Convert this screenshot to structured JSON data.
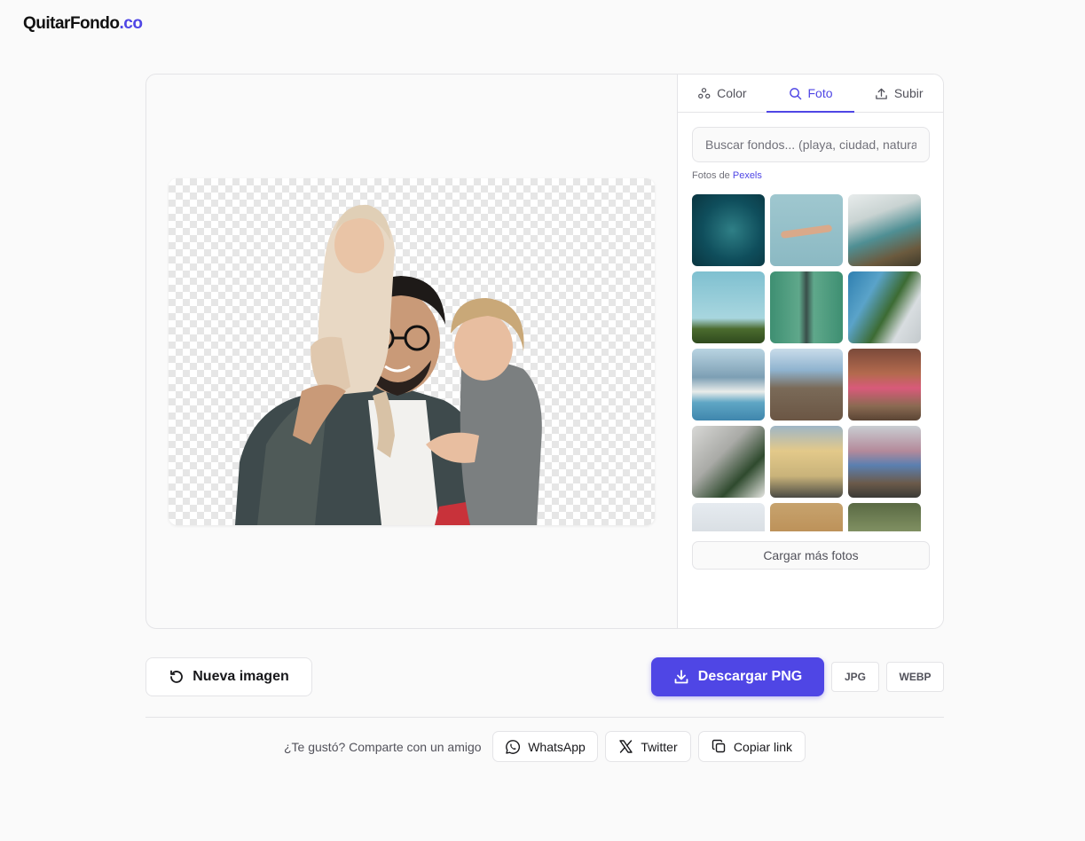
{
  "header": {
    "logo_main": "QuitarFondo",
    "logo_accent": ".co"
  },
  "tabs": [
    {
      "label": "Color",
      "icon": "palette-icon",
      "active": false
    },
    {
      "label": "Foto",
      "icon": "search-icon",
      "active": true
    },
    {
      "label": "Subir",
      "icon": "upload-icon",
      "active": false
    }
  ],
  "panel": {
    "search_placeholder": "Buscar fondos... (playa, ciudad, naturaleza)",
    "credit_prefix": "Fotos de ",
    "credit_link": "Pexels",
    "load_more": "Cargar más fotos"
  },
  "actions": {
    "new_image": "Nueva imagen",
    "download": "Descargar PNG",
    "jpg": "JPG",
    "webp": "WEBP"
  },
  "share": {
    "label": "¿Te gustó? Comparte con un amigo",
    "whatsapp": "WhatsApp",
    "twitter": "Twitter",
    "copy": "Copiar link"
  },
  "colors": {
    "accent": "#4f46e5",
    "border": "#e4e4e7",
    "background": "#fafafa"
  }
}
